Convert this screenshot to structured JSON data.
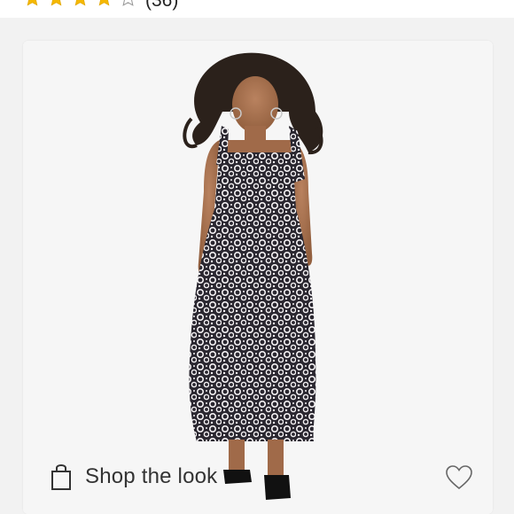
{
  "rating": {
    "stars_filled": 4,
    "stars_total": 5,
    "review_count": "(36)",
    "star_color": "#f5b800"
  },
  "product_card": {
    "shop_label": "Shop the look",
    "bag_icon": "shopping-bag-icon",
    "heart_icon": "heart-outline-icon",
    "image_description": "model-in-print-maxi-dress"
  }
}
